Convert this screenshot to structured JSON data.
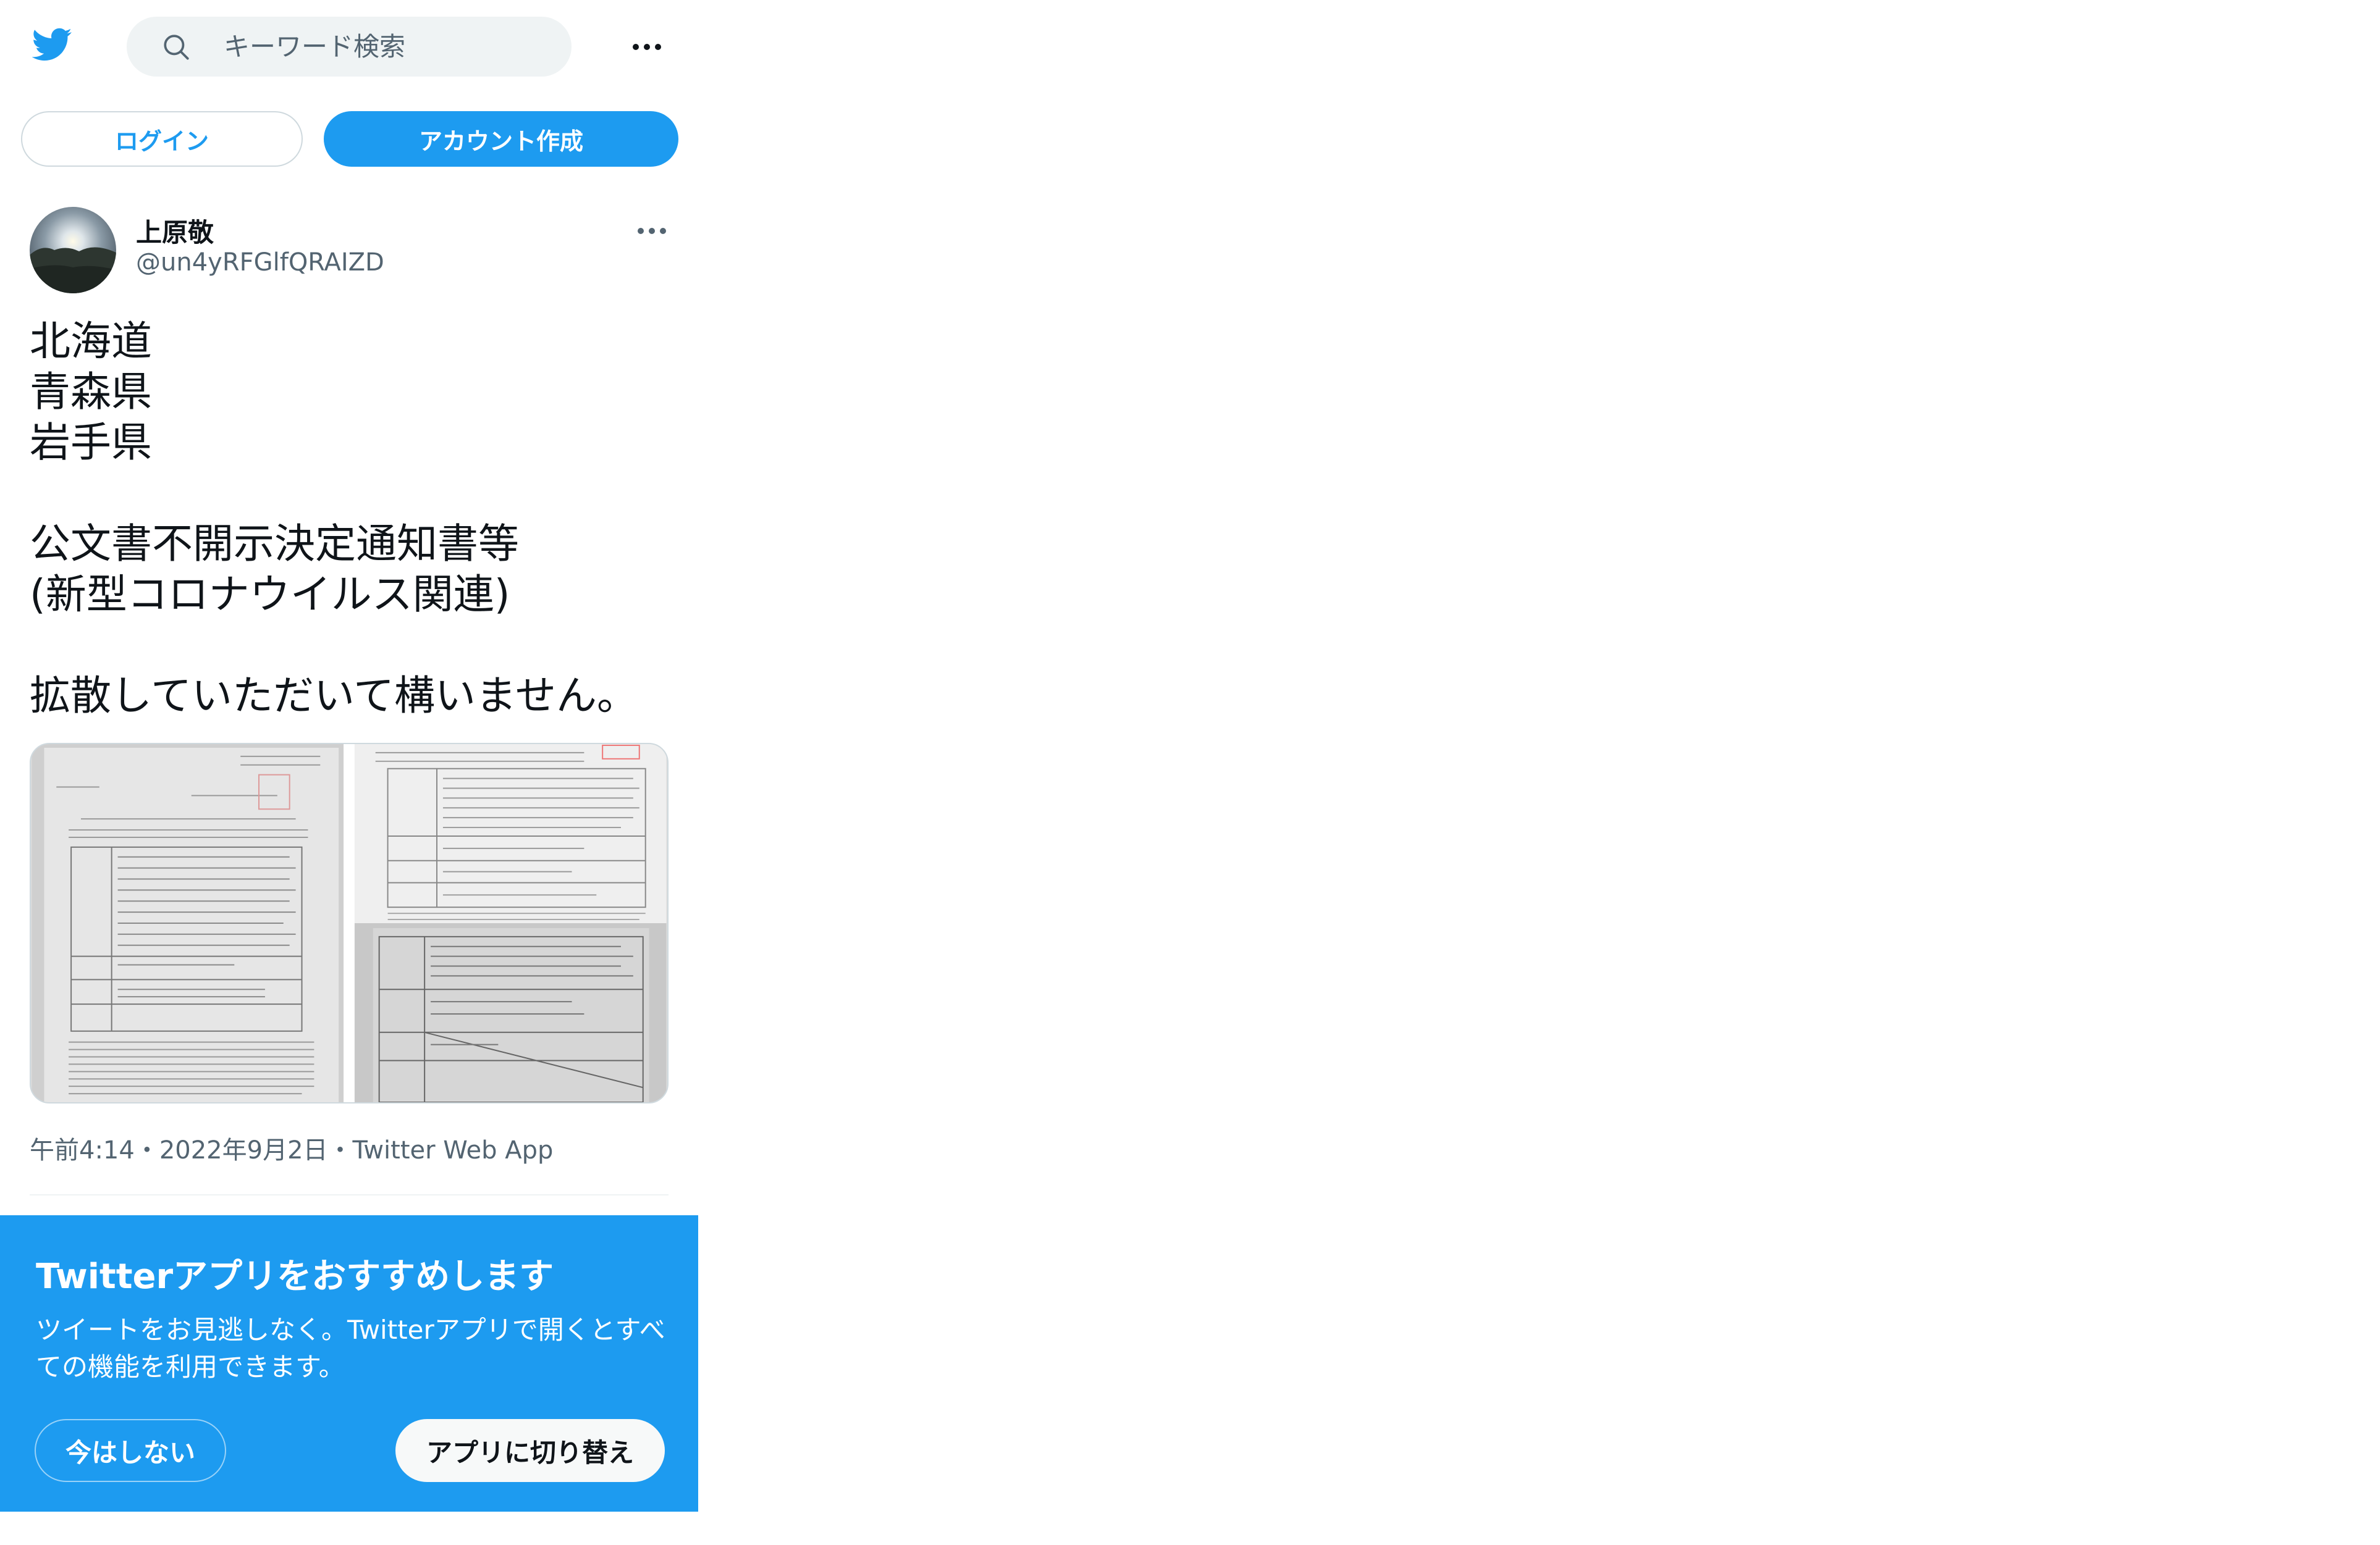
{
  "header": {
    "logo_icon": "twitter-bird-icon",
    "search_placeholder": "キーワード検索",
    "more_icon": "more-dots-icon"
  },
  "auth": {
    "login_label": "ログイン",
    "signup_label": "アカウント作成"
  },
  "tweet": {
    "display_name": "上原敬",
    "handle": "@un4yRFGlfQRAIZD",
    "lines": [
      "北海道",
      "青森県",
      "岩手県",
      "",
      "公文書不開示決定通知書等",
      "(新型コロナウイルス関連)",
      "",
      "拡散していただいて構いません。"
    ],
    "timestamp": "午前4:14・2022年9月2日・Twitter Web App"
  },
  "app_banner": {
    "title": "Twitterアプリをおすすめします",
    "body": "ツイートをお見逃しなく。Twitterアプリで開くとすべての機能を利用できます。",
    "not_now_label": "今はしない",
    "switch_label": "アプリに切り替え"
  },
  "colors": {
    "brand": "#1d9bf0",
    "text": "#0f1419",
    "secondary_text": "#536471",
    "border": "#cfd9de"
  }
}
